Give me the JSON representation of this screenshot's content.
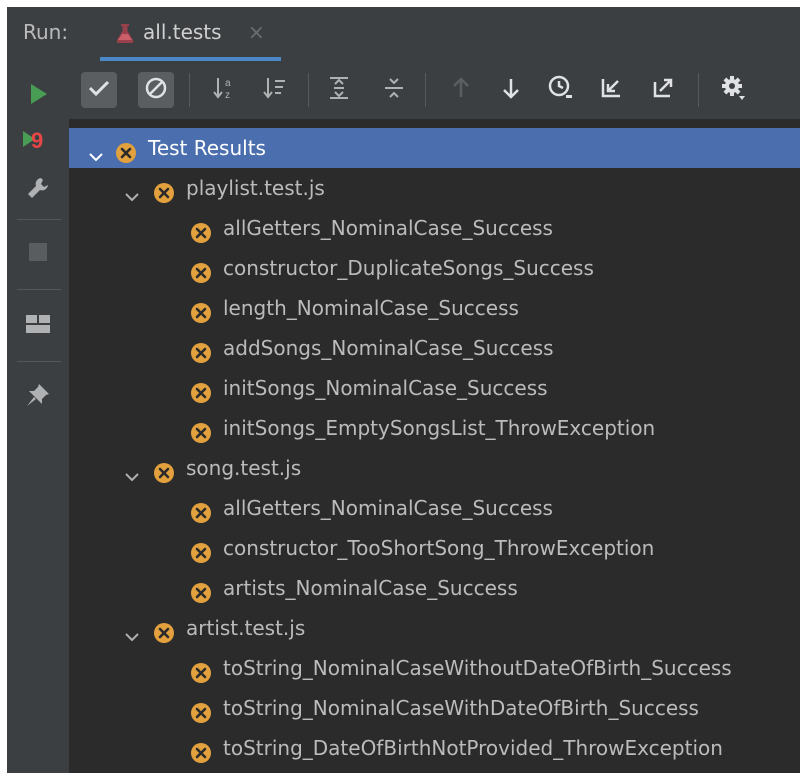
{
  "header": {
    "run_label": "Run:",
    "tab_title": "all.tests",
    "tab_close": "×"
  },
  "left_toolbar": {
    "rerun_count_badge": "9",
    "icons": [
      "play-icon",
      "rerun-failed-icon",
      "wrench-icon",
      "stop-icon",
      "layout-icon",
      "pin-icon"
    ]
  },
  "toolbar": {
    "icons": [
      "show-passed-icon",
      "show-ignored-icon",
      "sort-alphabetically-icon",
      "sort-by-duration-icon",
      "expand-all-icon",
      "collapse-all-icon",
      "previous-failed-icon",
      "next-failed-icon",
      "test-history-icon",
      "import-tests-icon",
      "export-results-icon",
      "settings-icon"
    ]
  },
  "tree": {
    "root": {
      "label": "Test Results"
    },
    "suites": [
      {
        "name": "playlist.test.js",
        "tests": [
          "allGetters_NominalCase_Success",
          "constructor_DuplicateSongs_Success",
          "length_NominalCase_Success",
          "addSongs_NominalCase_Success",
          "initSongs_NominalCase_Success",
          "initSongs_EmptySongsList_ThrowException"
        ]
      },
      {
        "name": "song.test.js",
        "tests": [
          "allGetters_NominalCase_Success",
          "constructor_TooShortSong_ThrowException",
          "artists_NominalCase_Success"
        ]
      },
      {
        "name": "artist.test.js",
        "tests": [
          "toString_NominalCaseWithoutDateOfBirth_Success",
          "toString_NominalCaseWithDateOfBirth_Success",
          "toString_DateOfBirthNotProvided_ThrowException"
        ]
      }
    ]
  },
  "colors": {
    "panel": "#3c3f41",
    "tree_bg": "#2b2b2b",
    "selection": "#4b6eaf",
    "fail_icon": "#e2a13d",
    "run_green": "#499c54",
    "tab_underline": "#4a88c7"
  }
}
